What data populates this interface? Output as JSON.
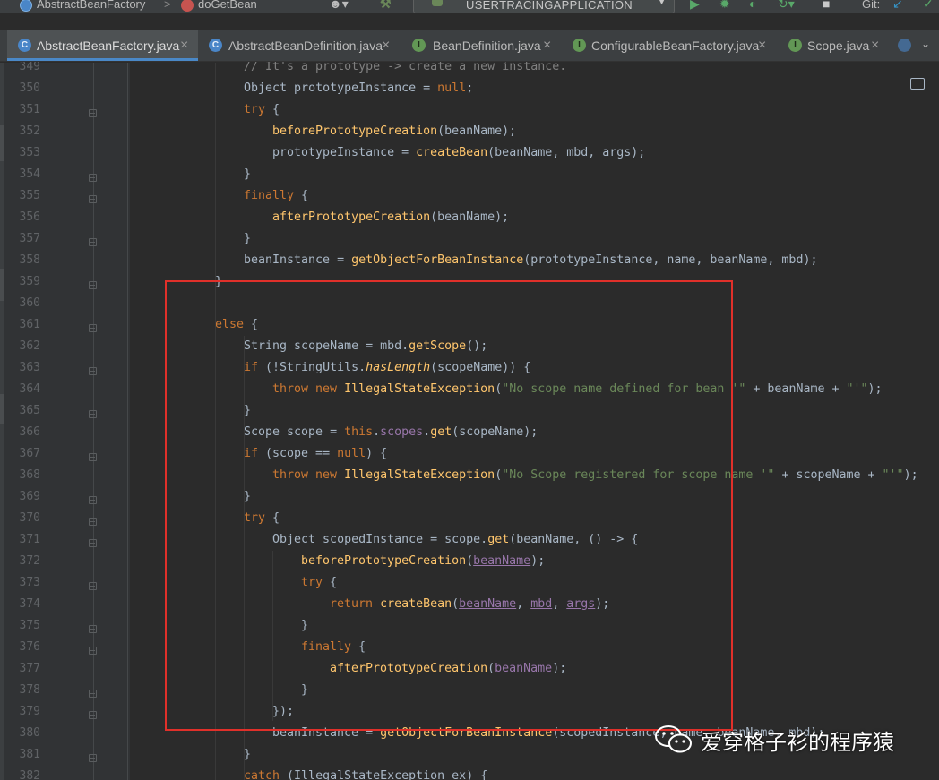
{
  "breadcrumbs": {
    "class_name": "AbstractBeanFactory",
    "separator": ">",
    "method_name": "doGetBean"
  },
  "toolbar": {
    "run_config": "USERTRACINGAPPLICATION",
    "git_label": "Git:"
  },
  "tabs": [
    {
      "label": "AbstractBeanFactory.java",
      "icon": "class-c",
      "active": true
    },
    {
      "label": "AbstractBeanDefinition.java",
      "icon": "class-c",
      "active": false
    },
    {
      "label": "BeanDefinition.java",
      "icon": "interface-i",
      "active": false
    },
    {
      "label": "ConfigurableBeanFactory.java",
      "icon": "interface-i",
      "active": false
    },
    {
      "label": "Scope.java",
      "icon": "interface-i",
      "active": false
    }
  ],
  "tab_close": "×",
  "code_lines": [
    {
      "n": "349",
      "indent": 4,
      "html": "<span class=\"cmt\">// It's a prototype -> create a new instance.</span>"
    },
    {
      "n": "350",
      "indent": 4,
      "html": "<span class=\"typ\">Object</span> prototypeInstance = <span class=\"kw\">null</span>;"
    },
    {
      "n": "351",
      "indent": 4,
      "html": "<span class=\"kw\">try</span> {"
    },
    {
      "n": "352",
      "indent": 5,
      "html": "<span class=\"mth\">beforePrototypeCreation</span>(beanName);"
    },
    {
      "n": "353",
      "indent": 5,
      "html": "prototypeInstance = <span class=\"mth\">createBean</span>(beanName, mbd, args);"
    },
    {
      "n": "354",
      "indent": 4,
      "html": "}"
    },
    {
      "n": "355",
      "indent": 4,
      "html": "<span class=\"kw\">finally</span> {"
    },
    {
      "n": "356",
      "indent": 5,
      "html": "<span class=\"mth\">afterPrototypeCreation</span>(beanName);"
    },
    {
      "n": "357",
      "indent": 4,
      "html": "}"
    },
    {
      "n": "358",
      "indent": 4,
      "html": "beanInstance = <span class=\"mth\">getObjectForBeanInstance</span>(prototypeInstance, name, beanName, mbd);"
    },
    {
      "n": "359",
      "indent": 3,
      "html": "}"
    },
    {
      "n": "360",
      "indent": 3,
      "html": ""
    },
    {
      "n": "361",
      "indent": 3,
      "html": "<span class=\"kw\">else</span> {"
    },
    {
      "n": "362",
      "indent": 4,
      "html": "<span class=\"typ\">String</span> scopeName = mbd.<span class=\"mth\">getScope</span>();"
    },
    {
      "n": "363",
      "indent": 4,
      "html": "<span class=\"kw\">if</span> (!StringUtils.<span class=\"st\">hasLength</span>(scopeName)) {"
    },
    {
      "n": "364",
      "indent": 5,
      "html": "<span class=\"kw\">throw new</span> <span class=\"mth\">IllegalStateException</span>(<span class=\"str\">\"No scope name defined for bean '\"</span> + beanName + <span class=\"str\">\"'\"</span>);"
    },
    {
      "n": "365",
      "indent": 4,
      "html": "}"
    },
    {
      "n": "366",
      "indent": 4,
      "html": "<span class=\"typ\">Scope</span> scope = <span class=\"kw\">this</span>.<span class=\"fld\">scopes</span>.<span class=\"mth\">get</span>(scopeName);"
    },
    {
      "n": "367",
      "indent": 4,
      "html": "<span class=\"kw\">if</span> (scope == <span class=\"kw\">null</span>) {"
    },
    {
      "n": "368",
      "indent": 5,
      "html": "<span class=\"kw\">throw new</span> <span class=\"mth\">IllegalStateException</span>(<span class=\"str\">\"No Scope registered for scope name '\"</span> + scopeName + <span class=\"str\">\"'\"</span>);"
    },
    {
      "n": "369",
      "indent": 4,
      "html": "}"
    },
    {
      "n": "370",
      "indent": 4,
      "html": "<span class=\"kw\">try</span> {"
    },
    {
      "n": "371",
      "indent": 5,
      "html": "<span class=\"typ\">Object</span> scopedInstance = scope.<span class=\"mth\">get</span>(beanName, () -> {"
    },
    {
      "n": "372",
      "indent": 6,
      "html": "<span class=\"mth\">beforePrototypeCreation</span>(<span class=\"cap\">beanName</span>);"
    },
    {
      "n": "373",
      "indent": 6,
      "html": "<span class=\"kw\">try</span> {"
    },
    {
      "n": "374",
      "indent": 7,
      "html": "<span class=\"kw\">return</span> <span class=\"mth\">createBean</span>(<span class=\"cap\">beanName</span>, <span class=\"cap\">mbd</span>, <span class=\"cap\">args</span>);"
    },
    {
      "n": "375",
      "indent": 6,
      "html": "}"
    },
    {
      "n": "376",
      "indent": 6,
      "html": "<span class=\"kw\">finally</span> {"
    },
    {
      "n": "377",
      "indent": 7,
      "html": "<span class=\"mth\">afterPrototypeCreation</span>(<span class=\"cap\">beanName</span>);"
    },
    {
      "n": "378",
      "indent": 6,
      "html": "}"
    },
    {
      "n": "379",
      "indent": 5,
      "html": "});"
    },
    {
      "n": "380",
      "indent": 5,
      "html": "beanInstance = <span class=\"mth\">getObjectForBeanInstance</span>(scopedInstance, name, beanName, mbd);"
    },
    {
      "n": "381",
      "indent": 4,
      "html": "}"
    },
    {
      "n": "382",
      "indent": 4,
      "html": "<span class=\"kw\">catch</span> (<span class=\"typ\">IllegalStateException</span> ex) {"
    }
  ],
  "fold_lines": [
    "351",
    "354",
    "355",
    "357",
    "359",
    "361",
    "363",
    "365",
    "367",
    "369",
    "370",
    "371",
    "373",
    "375",
    "376",
    "378",
    "379",
    "381"
  ],
  "watermark": {
    "text": "爱穿格子衫的程序猿",
    "icon": "wechat-icon"
  },
  "colors": {
    "highlight_box": "#e0302a",
    "editor_bg": "#2b2b2b",
    "keyword": "#cc7832",
    "method": "#ffc66d",
    "string": "#6a8759",
    "field": "#9876aa"
  }
}
